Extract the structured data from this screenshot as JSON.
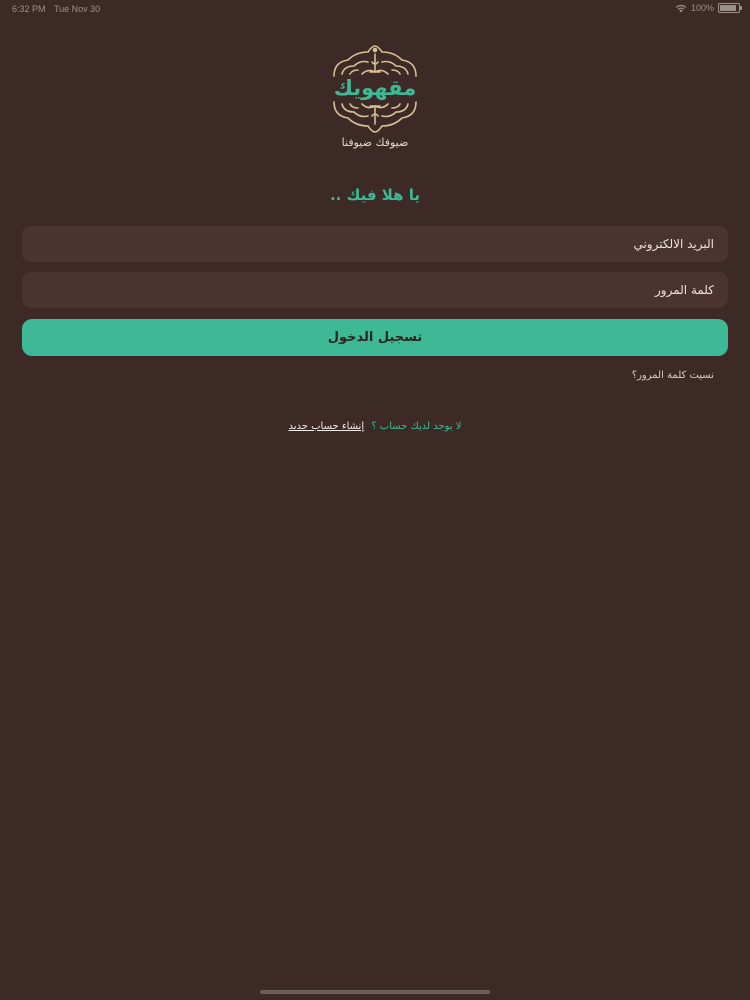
{
  "status_bar": {
    "time": "6:32 PM",
    "date": "Tue Nov 30",
    "battery": "100%"
  },
  "logo": {
    "word": "مقهويك"
  },
  "tagline": "ضيوفك ضيوفنا",
  "welcome": "يا هلا فيك ..",
  "form": {
    "email_placeholder": "البريد الالكتروني",
    "email_value": "",
    "password_placeholder": "كلمة المرور",
    "password_value": "",
    "login_label": "تسجيل الدخول",
    "forgot_label": "نسيت كلمة المرور؟"
  },
  "signup": {
    "question": "لا يوجد لديك حساب ؟",
    "link": "إنشاء حساب جديد"
  },
  "colors": {
    "background": "#3d2a26",
    "accent": "#3dba95",
    "field": "#4a3330",
    "ornament": "#d9bf95"
  }
}
